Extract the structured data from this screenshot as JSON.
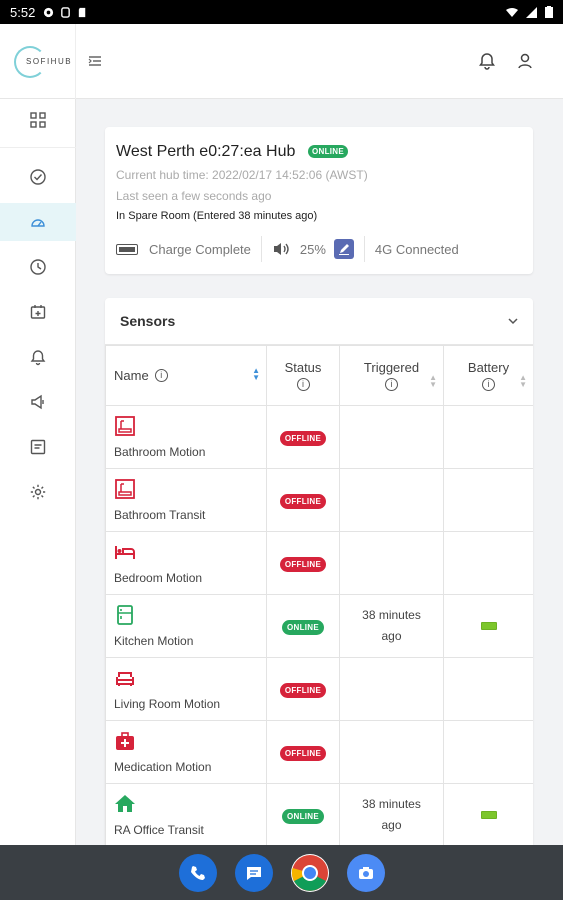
{
  "status_bar": {
    "time": "5:52"
  },
  "header": {
    "logo_text": "SOFIHUB"
  },
  "hub": {
    "title": "West Perth e0:27:ea Hub",
    "status": "ONLINE",
    "current_time": "Current hub time: 2022/02/17 14:52:06 (AWST)",
    "last_seen": "Last seen a few seconds ago",
    "room": "In Spare Room (Entered 38 minutes ago)",
    "charge": "Charge Complete",
    "volume": "25%",
    "connection": "4G Connected"
  },
  "sensors": {
    "title": "Sensors",
    "columns": {
      "name": "Name",
      "status": "Status",
      "triggered": "Triggered",
      "battery": "Battery"
    },
    "rows": [
      {
        "name": "Bathroom Motion",
        "icon": "bath-icon",
        "status": "OFFLINE",
        "triggered": "",
        "battery": ""
      },
      {
        "name": "Bathroom Transit",
        "icon": "bath-icon",
        "status": "OFFLINE",
        "triggered": "",
        "battery": ""
      },
      {
        "name": "Bedroom Motion",
        "icon": "bed-icon",
        "status": "OFFLINE",
        "triggered": "",
        "battery": ""
      },
      {
        "name": "Kitchen Motion",
        "icon": "fridge-icon",
        "status": "ONLINE",
        "triggered": "38 minutes ago",
        "battery": "full"
      },
      {
        "name": "Living Room Motion",
        "icon": "sofa-icon",
        "status": "OFFLINE",
        "triggered": "",
        "battery": ""
      },
      {
        "name": "Medication Motion",
        "icon": "medical-kit-icon",
        "status": "OFFLINE",
        "triggered": "",
        "battery": ""
      },
      {
        "name": "RA Office Transit",
        "icon": "house-icon",
        "status": "ONLINE",
        "triggered": "38 minutes ago",
        "battery": "full"
      }
    ]
  },
  "colors": {
    "offline": "#d6233b",
    "online": "#27a85f",
    "accent": "#3d8fd8",
    "battery": "#7cc62b"
  }
}
